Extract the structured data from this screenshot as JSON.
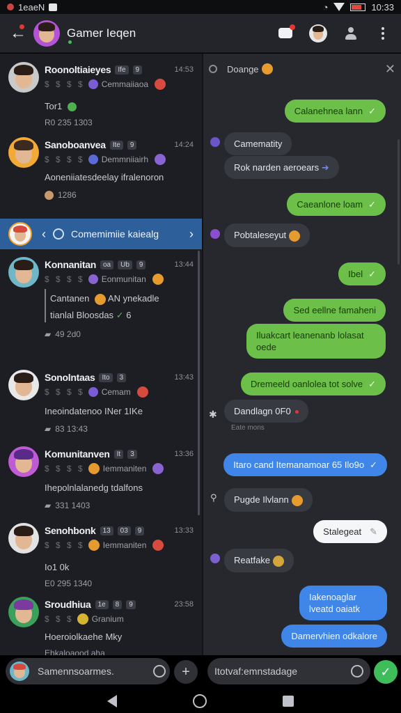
{
  "status_bar": {
    "left_text": "1eaeN",
    "time": "10:33"
  },
  "header": {
    "title": "Gamer Ieqen"
  },
  "conversations": [
    {
      "name": "Roonoltiaieyes",
      "tags": [
        "Ife",
        "9"
      ],
      "time": "14:53",
      "sub": "Cemmaiiaoa",
      "line1": "Tor1",
      "meta": "R0 235   1303"
    },
    {
      "name": "Sanoboanvea",
      "tags": [
        "Ite",
        "9"
      ],
      "time": "14:24",
      "sub": "Demmniiairh",
      "line1": "Aoneniiatesdeelay ifralenoron",
      "meta": "1286"
    },
    {
      "name": "Konnanitan",
      "tags": [
        "oa",
        "Ub",
        "9"
      ],
      "time": "13:44",
      "sub": "Eonmunitan",
      "line1": "Cantanen",
      "line1b": "AN ynekadle",
      "line2": "tianlal Bloosdas",
      "line2b": "6",
      "meta": "49   2d0"
    },
    {
      "name": "Sonolntaas",
      "tags": [
        "Ito",
        "3"
      ],
      "time": "13:43",
      "sub": "Cemam",
      "line1": "Ineoindatenoo INer 1IKe",
      "meta": "83   13:43"
    },
    {
      "name": "Komunitanven",
      "tags": [
        "It",
        "3"
      ],
      "time": "13:36",
      "sub": "Iemmaniten",
      "line1": "Ihepolnlalanedg tdalfons",
      "meta": "331   1403"
    },
    {
      "name": "Senohbonk",
      "tags": [
        "13",
        "03",
        "9"
      ],
      "time": "13:33",
      "sub": "Iemmaniten",
      "line1": "Io1 0k",
      "line1b": "",
      "meta": "E0 295   1340"
    },
    {
      "name": "Sroudhiua",
      "tags": [
        "1e",
        "8",
        "9"
      ],
      "time": "23:58",
      "sub": "Granium",
      "line1": "Hoeroiolkaehe Mky",
      "meta": "Ehkaloaood aha"
    }
  ],
  "highlight": {
    "label": "Comemimiie kaiealg"
  },
  "left_input": {
    "placeholder": "Samennsoarmes."
  },
  "right_header": {
    "title": "Doange"
  },
  "messages": [
    {
      "dir": "out",
      "text": "Calanehnea lann"
    },
    {
      "dir": "in",
      "text": "Camematity"
    },
    {
      "dir": "in",
      "text": "Rok narden aeroears"
    },
    {
      "dir": "out",
      "text": "Caeanlone loam"
    },
    {
      "dir": "in",
      "text": "Pobtaleseyut"
    },
    {
      "dir": "out",
      "text": "Ibel"
    },
    {
      "dir": "out",
      "text": "Sed eellne famaheni"
    },
    {
      "dir": "out",
      "text": "Iluakcart leanenanb lolasat oede"
    },
    {
      "dir": "out",
      "text": "Dremeeld oanlolea tot solve"
    },
    {
      "dir": "in",
      "text": "Dandlagn 0F0",
      "meta": "Eate mons"
    },
    {
      "dir": "blue",
      "text": "Itaro cand Itemanamoar 65 Ilo9o"
    },
    {
      "dir": "in",
      "text": "Pugde Ilvlann"
    },
    {
      "dir": "white",
      "text": "Stalegeat"
    },
    {
      "dir": "in",
      "text": "Reatfake"
    },
    {
      "dir": "blue",
      "text": "Iakenoaglar lveatd oaiatk"
    },
    {
      "dir": "blue",
      "text": "Damervhien odkalore"
    }
  ],
  "right_input": {
    "placeholder": "Itotvaf:emnstadage"
  },
  "colors": {
    "green": "#6cc04a",
    "blue": "#3f86e8",
    "panel": "#1c1e23",
    "highlight": "#2d5f9b"
  }
}
